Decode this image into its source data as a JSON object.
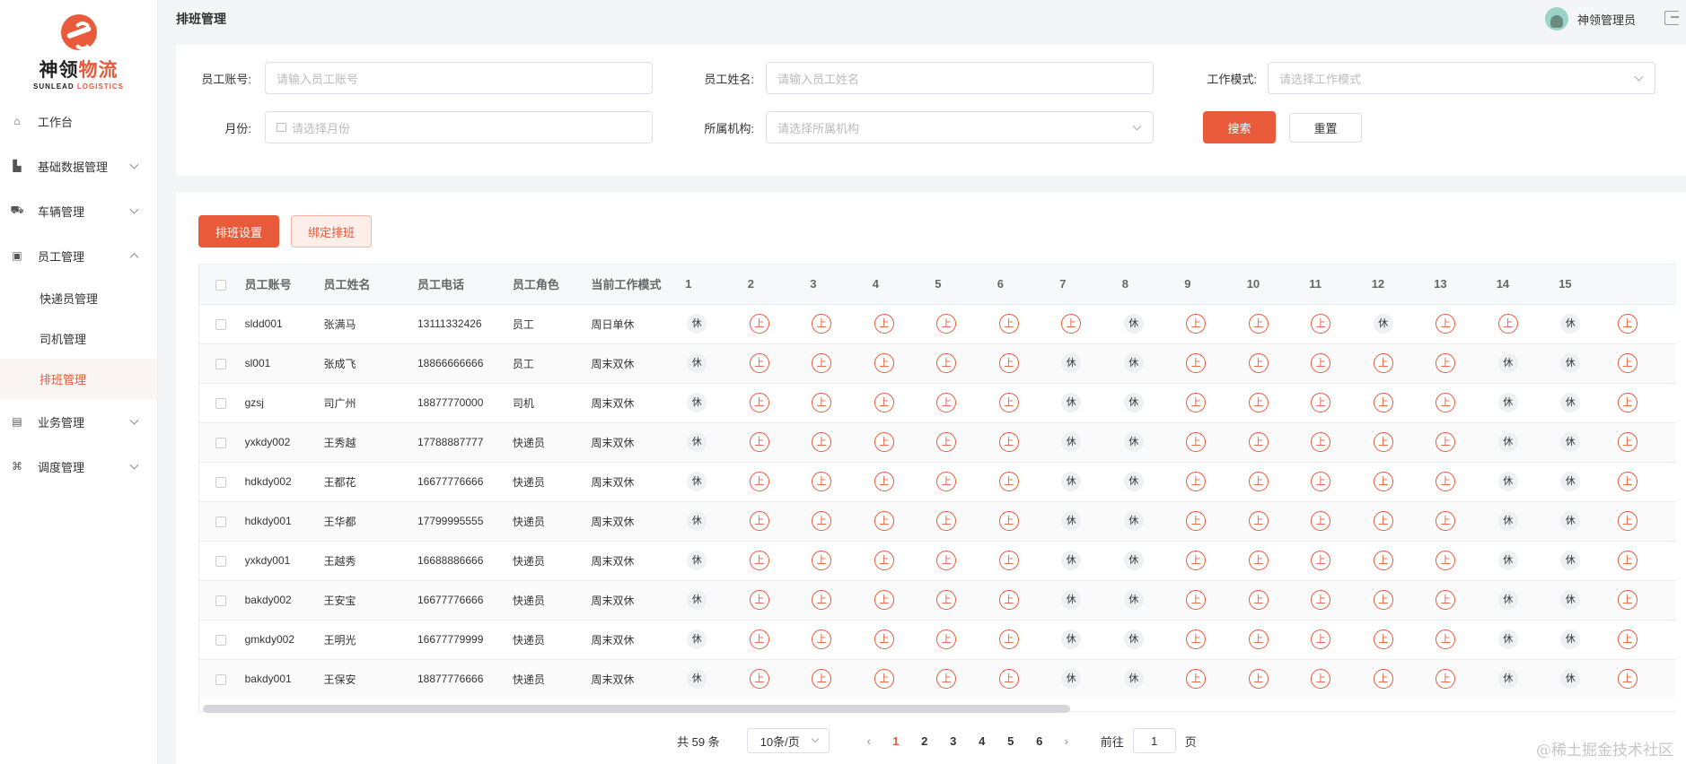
{
  "brand": {
    "cn_a": "神领",
    "cn_b": "物流",
    "en_a": "SUNLEAD",
    "en_b": "LOGISTICS"
  },
  "header": {
    "title": "排班管理",
    "user": "神领管理员"
  },
  "sidebar": {
    "items": [
      {
        "label": "工作台",
        "icon": "home-icon"
      },
      {
        "label": "基础数据管理",
        "icon": "chart-icon"
      },
      {
        "label": "车辆管理",
        "icon": "truck-icon"
      },
      {
        "label": "员工管理",
        "icon": "id-card-icon"
      },
      {
        "label": "业务管理",
        "icon": "book-icon"
      },
      {
        "label": "调度管理",
        "icon": "dispatch-icon"
      }
    ],
    "sub_items": [
      "快递员管理",
      "司机管理",
      "排班管理"
    ]
  },
  "filters": {
    "account_label": "员工账号:",
    "account_placeholder": "请输入员工账号",
    "name_label": "员工姓名:",
    "name_placeholder": "请输入员工姓名",
    "mode_label": "工作模式:",
    "mode_placeholder": "请选择工作模式",
    "month_label": "月份:",
    "month_placeholder": "请选择月份",
    "org_label": "所属机构:",
    "org_placeholder": "请选择所属机构",
    "search": "搜索",
    "reset": "重置"
  },
  "actions": {
    "schedule_settings": "排班设置",
    "bind_schedule": "绑定排班"
  },
  "table": {
    "headers": [
      "员工账号",
      "员工姓名",
      "员工电话",
      "员工角色",
      "当前工作模式"
    ],
    "days": [
      "1",
      "2",
      "3",
      "4",
      "5",
      "6",
      "7",
      "8",
      "9",
      "10",
      "11",
      "12",
      "13",
      "14",
      "15"
    ],
    "rest_label": "休",
    "work_label": "上",
    "rows": [
      {
        "account": "sldd001",
        "name": "张满马",
        "phone": "13111332426",
        "role": "员工",
        "mode": "周日单休",
        "days": "RWWWWWWRWWWRWWRW"
      },
      {
        "account": "sl001",
        "name": "张成飞",
        "phone": "18866666666",
        "role": "员工",
        "mode": "周末双休",
        "days": "RWWWWWRRWWWWWRRW"
      },
      {
        "account": "gzsj",
        "name": "司广州",
        "phone": "18877770000",
        "role": "司机",
        "mode": "周末双休",
        "days": "RWWWWWRRWWWWWRRW"
      },
      {
        "account": "yxkdy002",
        "name": "王秀越",
        "phone": "17788887777",
        "role": "快递员",
        "mode": "周末双休",
        "days": "RWWWWWRRWWWWWRRW"
      },
      {
        "account": "hdkdy002",
        "name": "王都花",
        "phone": "16677776666",
        "role": "快递员",
        "mode": "周末双休",
        "days": "RWWWWWRRWWWWWRRW"
      },
      {
        "account": "hdkdy001",
        "name": "王华都",
        "phone": "17799995555",
        "role": "快递员",
        "mode": "周末双休",
        "days": "RWWWWWRRWWWWWRRW"
      },
      {
        "account": "yxkdy001",
        "name": "王越秀",
        "phone": "16688886666",
        "role": "快递员",
        "mode": "周末双休",
        "days": "RWWWWWRRWWWWWRRW"
      },
      {
        "account": "bakdy002",
        "name": "王安宝",
        "phone": "16677776666",
        "role": "快递员",
        "mode": "周末双休",
        "days": "RWWWWWRRWWWWWRRW"
      },
      {
        "account": "gmkdy002",
        "name": "王明光",
        "phone": "16677779999",
        "role": "快递员",
        "mode": "周末双休",
        "days": "RWWWWWRRWWWWWRRW"
      },
      {
        "account": "bakdy001",
        "name": "王保安",
        "phone": "18877776666",
        "role": "快递员",
        "mode": "周末双休",
        "days": "RWWWWWRRWWWWWRRW"
      }
    ]
  },
  "pagination": {
    "total": "共 59 条",
    "page_size": "10条/页",
    "pages": [
      "1",
      "2",
      "3",
      "4",
      "5",
      "6"
    ],
    "current": "1",
    "goto_label": "前往",
    "goto_value": "1",
    "page_unit": "页"
  },
  "watermark": "@稀土掘金技术社区",
  "colors": {
    "accent": "#e85a3a",
    "rest_bg": "#eef0f4"
  }
}
